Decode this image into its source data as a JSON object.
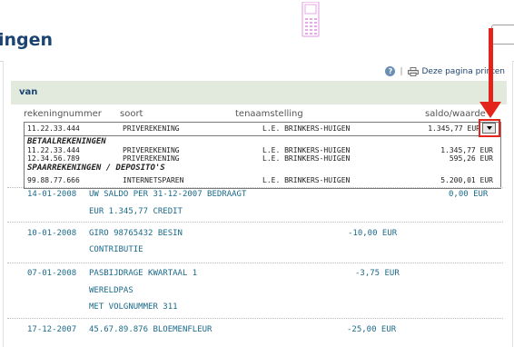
{
  "header": {
    "title": "ingen"
  },
  "toolbar": {
    "help_icon_glyph": "?",
    "separator": "|",
    "print_label": "Deze pagina printen"
  },
  "account_section": {
    "label": "van",
    "columns": {
      "number": "rekeningnummer",
      "type": "soort",
      "holder": "tenaamstelling",
      "balance": "saldo/waarde"
    },
    "selected": {
      "number": "11.22.33.444",
      "type": "PRIVEREKENING",
      "holder": "L.E. BRINKERS-HUIGEN",
      "balance": "1.345,77 EUR"
    },
    "groups": [
      {
        "name": "BETAALREKENINGEN",
        "accounts": [
          {
            "number": "11.22.33.444",
            "type": "PRIVEREKENING",
            "holder": "L.E. BRINKERS-HUIGEN",
            "balance": "1.345,77 EUR"
          },
          {
            "number": "12.34.56.789",
            "type": "PRIVEREKENING",
            "holder": "L.E. BRINKERS-HUIGEN",
            "balance": "595,26 EUR"
          }
        ]
      },
      {
        "name": "SPAARREKENINGEN / DEPOSITO'S",
        "accounts": [
          {
            "number": "99.88.77.666",
            "type": "INTERNETSPAREN",
            "holder": "L.E. BRINKERS-HUIGEN",
            "balance": "5.200,01 EUR"
          }
        ]
      }
    ]
  },
  "transactions": [
    {
      "date": "14-01-2008",
      "lines": [
        "UW SALDO PER 31-12-2007 BEDRAAGT",
        "EUR 1.345,77 CREDIT"
      ],
      "amount": "0,00 EUR"
    },
    {
      "date": "10-01-2008",
      "lines": [
        "GIRO 98765432 BESIN",
        "CONTRIBUTIE"
      ],
      "amount": "-10,00 EUR"
    },
    {
      "date": "07-01-2008",
      "lines": [
        "PASBIJDRAGE KWARTAAL 1",
        "WERELDPAS",
        "MET VOLGNUMMER 311"
      ],
      "amount": "-3,75 EUR"
    },
    {
      "date": "17-12-2007",
      "lines": [
        "45.67.89.876 BLOEMENFLEUR"
      ],
      "amount": "-25,00 EUR"
    }
  ],
  "icons": {
    "help": "help-icon",
    "print": "printer-icon",
    "phone": "phone-icon",
    "dropdown": "chevron-down-icon"
  },
  "colors": {
    "title": "#1c4472",
    "band": "#e2e9dd",
    "link": "#1c6a8a",
    "annotation": "#e2241b",
    "phone": "#e6a8e6"
  }
}
